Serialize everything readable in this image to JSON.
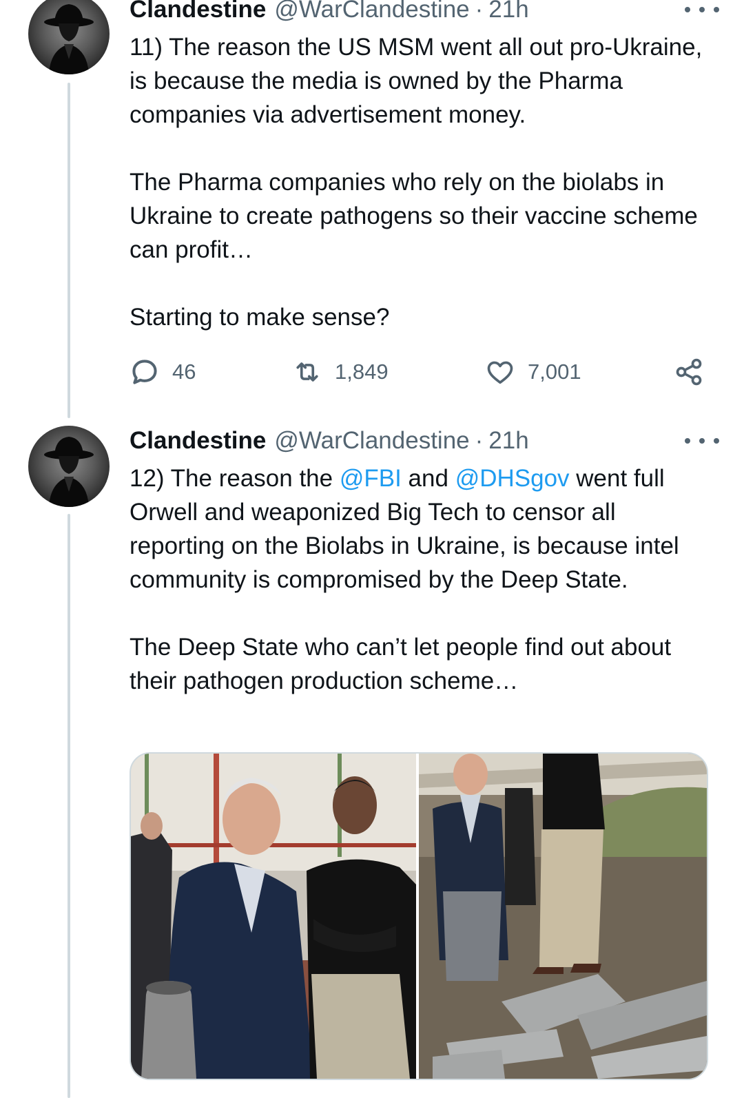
{
  "tweets": [
    {
      "name": "Clandestine",
      "handle": "@WarClandestine",
      "separator": "·",
      "time": "21h",
      "paragraphs": [
        "11) The reason the US MSM went  all out pro-Ukraine, is because the media is owned by the Pharma companies via advertisement money.",
        "The Pharma companies who rely on the biolabs in Ukraine to create pathogens so their vaccine scheme can profit…",
        "Starting to make sense?"
      ],
      "stats": {
        "replies": "46",
        "retweets": "1,849",
        "likes": "7,001"
      }
    },
    {
      "name": "Clandestine",
      "handle": "@WarClandestine",
      "separator": "·",
      "time": "21h",
      "p1_before": "12) The reason the ",
      "mention1": "@FBI",
      "p1_middle": " and ",
      "mention2": "@DHSgov",
      "p1_after": " went full Orwell and weaponized Big Tech to censor all reporting on the Biolabs in Ukraine, is because intel community is compromised by the Deep State.",
      "p2": "The Deep State who can’t let people find out about their pathogen production scheme…"
    }
  ],
  "icons": {
    "more": "more-horizontal-icon",
    "reply": "reply-bubble-icon",
    "retweet": "retweet-arrows-icon",
    "like": "heart-icon",
    "share": "share-nodes-icon",
    "avatar": "fedora-silhouette-avatar"
  },
  "colors": {
    "link": "#1d9bf0",
    "muted": "#536471",
    "thread_line": "#cfd9de"
  }
}
